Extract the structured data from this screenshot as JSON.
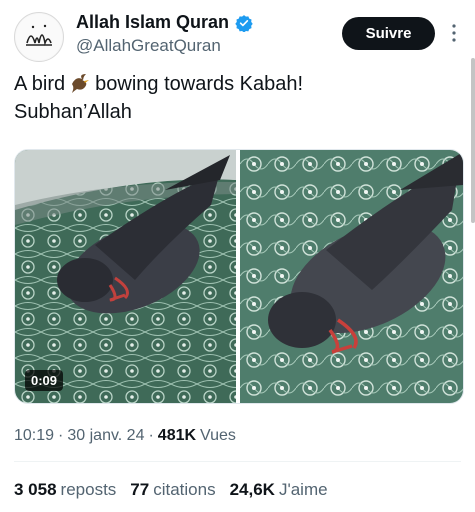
{
  "account": {
    "display_name": "Allah Islam Quran",
    "handle": "@AllahGreatQuran",
    "verified": true
  },
  "follow_button": "Suivre",
  "tweet": {
    "line1_before": "A bird",
    "line1_after": "bowing towards Kabah!",
    "line2": "Subhan’Allah",
    "emoji": "bird-icon"
  },
  "media": {
    "duration": "0:09"
  },
  "meta": {
    "time": "10:19",
    "sep1": "·",
    "date": "30 janv. 24",
    "sep2": "·",
    "views_count": "481K",
    "views_label": "Vues"
  },
  "stats": {
    "reposts_count": "3 058",
    "reposts_label": "reposts",
    "citations_count": "77",
    "citations_label": "citations",
    "likes_count": "24,6K",
    "likes_label": "J'aime"
  },
  "colors": {
    "text": "#0f1419",
    "secondary": "#536471",
    "verified": "#1d9bf0",
    "button": "#0f1419"
  }
}
